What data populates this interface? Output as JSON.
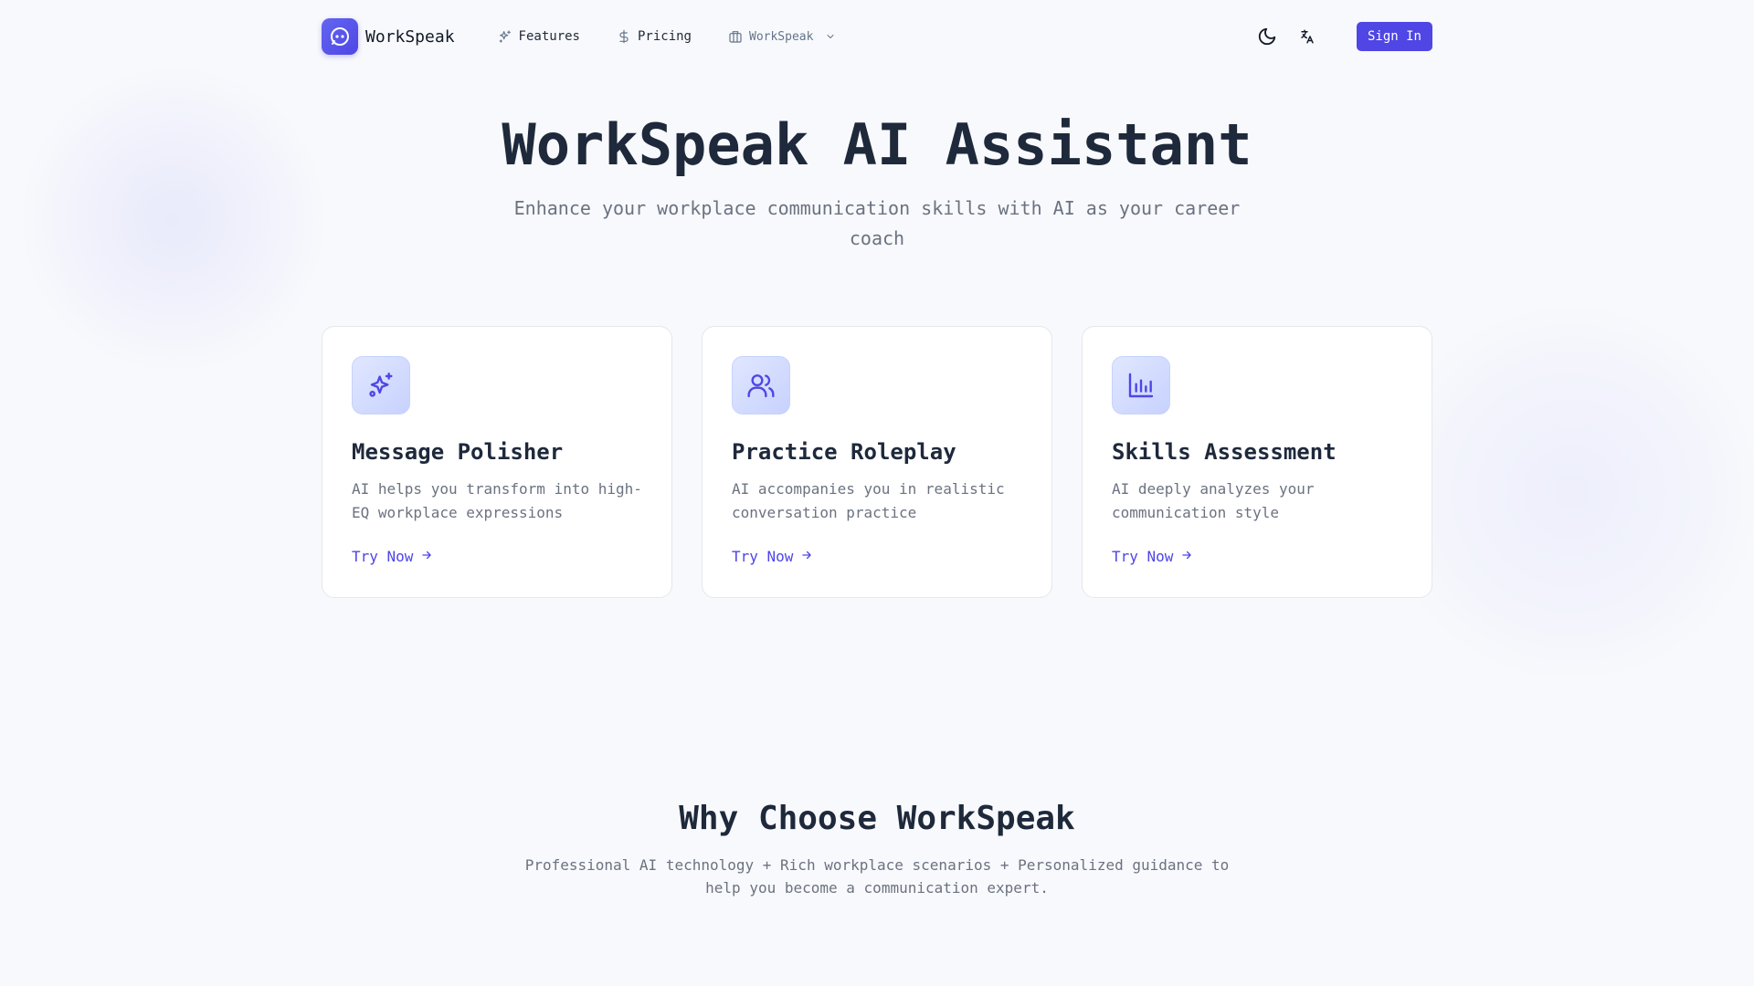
{
  "header": {
    "brand": "WorkSpeak",
    "nav": [
      {
        "label": "Features",
        "icon": "sparkles-icon"
      },
      {
        "label": "Pricing",
        "icon": "dollar-icon"
      },
      {
        "label": "WorkSpeak",
        "icon": "building-icon"
      }
    ],
    "signin_label": "Sign In"
  },
  "hero": {
    "title": "WorkSpeak AI Assistant",
    "subtitle": "Enhance your workplace communication skills with AI as your career coach"
  },
  "cards": [
    {
      "title": "Message Polisher",
      "desc": "AI helps you transform into high-EQ workplace expressions",
      "link": "Try Now",
      "icon": "sparkles-icon"
    },
    {
      "title": "Practice Roleplay",
      "desc": "AI accompanies you in realistic conversation practice",
      "link": "Try Now",
      "icon": "users-icon"
    },
    {
      "title": "Skills Assessment",
      "desc": "AI deeply analyzes your communication style",
      "link": "Try Now",
      "icon": "bar-chart-icon"
    }
  ],
  "why": {
    "title": "Why Choose WorkSpeak",
    "subtitle": "Professional AI technology + Rich workplace scenarios + Personalized guidance to help you become a communication expert."
  },
  "colors": {
    "accent": "#4f46e5",
    "background": "#f8f9fc",
    "text": "#1e293b",
    "muted": "#6b7280"
  }
}
